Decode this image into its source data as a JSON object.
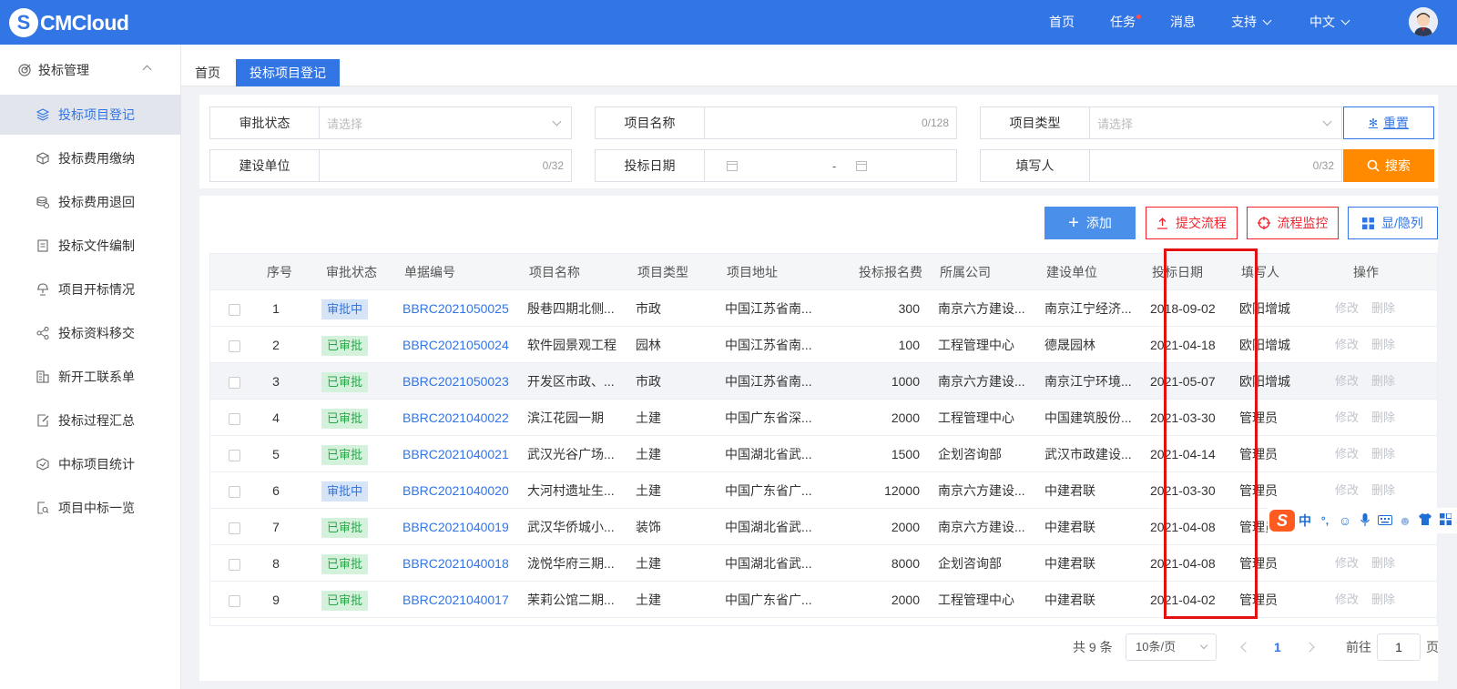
{
  "brand": {
    "logo_mark": "S",
    "name": "CMCloud"
  },
  "topnav": {
    "home": "首页",
    "tasks": "任务",
    "messages": "消息",
    "support": "支持",
    "language": "中文"
  },
  "sidebar": {
    "group": "投标管理",
    "items": [
      {
        "label": "投标项目登记",
        "icon": "layers-icon",
        "active": true
      },
      {
        "label": "投标费用缴纳",
        "icon": "cube-icon"
      },
      {
        "label": "投标费用退回",
        "icon": "coins-icon"
      },
      {
        "label": "投标文件编制",
        "icon": "document-icon"
      },
      {
        "label": "项目开标情况",
        "icon": "lamp-icon"
      },
      {
        "label": "投标资料移交",
        "icon": "share-icon"
      },
      {
        "label": "新开工联系单",
        "icon": "building-icon"
      },
      {
        "label": "投标过程汇总",
        "icon": "edit-doc-icon"
      },
      {
        "label": "中标项目统计",
        "icon": "hexagon-icon"
      },
      {
        "label": "项目中标一览",
        "icon": "doc-search-icon"
      }
    ]
  },
  "tabs": [
    "首页",
    "投标项目登记"
  ],
  "filters": {
    "approval_status": {
      "label": "审批状态",
      "placeholder": "请选择"
    },
    "project_name": {
      "label": "项目名称",
      "counter": "0/128"
    },
    "project_type": {
      "label": "项目类型",
      "placeholder": "请选择"
    },
    "construction_unit": {
      "label": "建设单位",
      "counter": "0/32"
    },
    "bid_date": {
      "label": "投标日期",
      "separator": "-"
    },
    "filler": {
      "label": "填写人",
      "counter": "0/32"
    },
    "reset_label": "重置",
    "search_label": "搜索"
  },
  "toolbar": {
    "add": "添加",
    "submit_flow": "提交流程",
    "flow_monitor": "流程监控",
    "toggle_columns": "显/隐列"
  },
  "table": {
    "headers": [
      "序号",
      "审批状态",
      "单据编号",
      "项目名称",
      "项目类型",
      "项目地址",
      "投标报名费",
      "所属公司",
      "建设单位",
      "投标日期",
      "填写人",
      "操作"
    ],
    "edit_label": "修改",
    "delete_label": "删除",
    "rows": [
      {
        "no": "1",
        "status": "审批中",
        "status_kind": "pending",
        "code": "BBRC2021050025",
        "name": "殷巷四期北侧...",
        "type": "市政",
        "address": "中国江苏省南...",
        "fee": "300",
        "company": "南京六方建设...",
        "unit": "南京江宁经济...",
        "date": "2018-09-02",
        "filler": "欧阳增城"
      },
      {
        "no": "2",
        "status": "已审批",
        "status_kind": "approved",
        "code": "BBRC2021050024",
        "name": "软件园景观工程",
        "type": "园林",
        "address": "中国江苏省南...",
        "fee": "100",
        "company": "工程管理中心",
        "unit": "德晟园林",
        "date": "2021-04-18",
        "filler": "欧阳增城"
      },
      {
        "no": "3",
        "status": "已审批",
        "status_kind": "approved",
        "code": "BBRC2021050023",
        "name": "开发区市政、...",
        "type": "市政",
        "address": "中国江苏省南...",
        "fee": "1000",
        "company": "南京六方建设...",
        "unit": "南京江宁环境...",
        "date": "2021-05-07",
        "filler": "欧阳增城"
      },
      {
        "no": "4",
        "status": "已审批",
        "status_kind": "approved",
        "code": "BBRC2021040022",
        "name": "滨江花园一期",
        "type": "土建",
        "address": "中国广东省深...",
        "fee": "2000",
        "company": "工程管理中心",
        "unit": "中国建筑股份...",
        "date": "2021-03-30",
        "filler": "管理员"
      },
      {
        "no": "5",
        "status": "已审批",
        "status_kind": "approved",
        "code": "BBRC2021040021",
        "name": "武汉光谷广场...",
        "type": "土建",
        "address": "中国湖北省武...",
        "fee": "1500",
        "company": "企划咨询部",
        "unit": "武汉市政建设...",
        "date": "2021-04-14",
        "filler": "管理员"
      },
      {
        "no": "6",
        "status": "审批中",
        "status_kind": "pending",
        "code": "BBRC2021040020",
        "name": "大河村遗址生...",
        "type": "土建",
        "address": "中国广东省广...",
        "fee": "12000",
        "company": "南京六方建设...",
        "unit": "中建君联",
        "date": "2021-03-30",
        "filler": "管理员"
      },
      {
        "no": "7",
        "status": "已审批",
        "status_kind": "approved",
        "code": "BBRC2021040019",
        "name": "武汉华侨城小...",
        "type": "装饰",
        "address": "中国湖北省武...",
        "fee": "2000",
        "company": "南京六方建设...",
        "unit": "中建君联",
        "date": "2021-04-08",
        "filler": "管理员"
      },
      {
        "no": "8",
        "status": "已审批",
        "status_kind": "approved",
        "code": "BBRC2021040018",
        "name": "泷悦华府三期...",
        "type": "土建",
        "address": "中国湖北省武...",
        "fee": "8000",
        "company": "企划咨询部",
        "unit": "中建君联",
        "date": "2021-04-08",
        "filler": "管理员"
      },
      {
        "no": "9",
        "status": "已审批",
        "status_kind": "approved",
        "code": "BBRC2021040017",
        "name": "茉莉公馆二期...",
        "type": "土建",
        "address": "中国广东省广...",
        "fee": "2000",
        "company": "工程管理中心",
        "unit": "中建君联",
        "date": "2021-04-02",
        "filler": "管理员"
      }
    ]
  },
  "pagination": {
    "total_text": "共 9 条",
    "page_size": "10条/页",
    "current_page": "1",
    "goto_prefix": "前往",
    "goto_value": "1",
    "goto_suffix": "页"
  },
  "ime": {
    "logo": "S",
    "mode": "中",
    "punct": "°,"
  },
  "colors": {
    "primary": "#3275e4",
    "search": "#ff8a00",
    "danger": "#f5222d",
    "highlight_box": "#e31212"
  }
}
